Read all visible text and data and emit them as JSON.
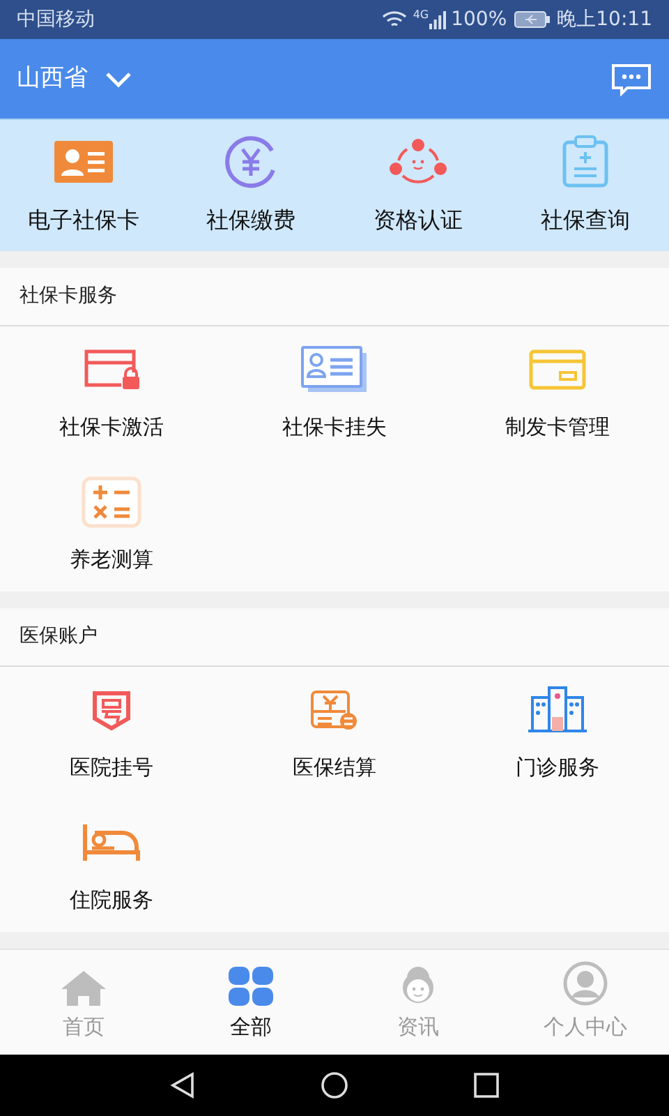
{
  "status_bar": {
    "carrier": "中国移动",
    "network": "4G",
    "battery": "100%",
    "time": "晚上10:11"
  },
  "header": {
    "province": "山西省"
  },
  "quick_actions": [
    {
      "label": "电子社保卡"
    },
    {
      "label": "社保缴费"
    },
    {
      "label": "资格认证"
    },
    {
      "label": "社保查询"
    }
  ],
  "sections": [
    {
      "title": "社保卡服务",
      "items": [
        {
          "label": "社保卡激活"
        },
        {
          "label": "社保卡挂失"
        },
        {
          "label": "制发卡管理"
        },
        {
          "label": "养老测算"
        }
      ]
    },
    {
      "title": "医保账户",
      "items": [
        {
          "label": "医院挂号"
        },
        {
          "label": "医保结算"
        },
        {
          "label": "门诊服务"
        },
        {
          "label": "住院服务"
        }
      ]
    }
  ],
  "tab_bar": [
    {
      "label": "首页",
      "selected": false
    },
    {
      "label": "全部",
      "selected": true
    },
    {
      "label": "资讯",
      "selected": false
    },
    {
      "label": "个人中心",
      "selected": false
    }
  ]
}
